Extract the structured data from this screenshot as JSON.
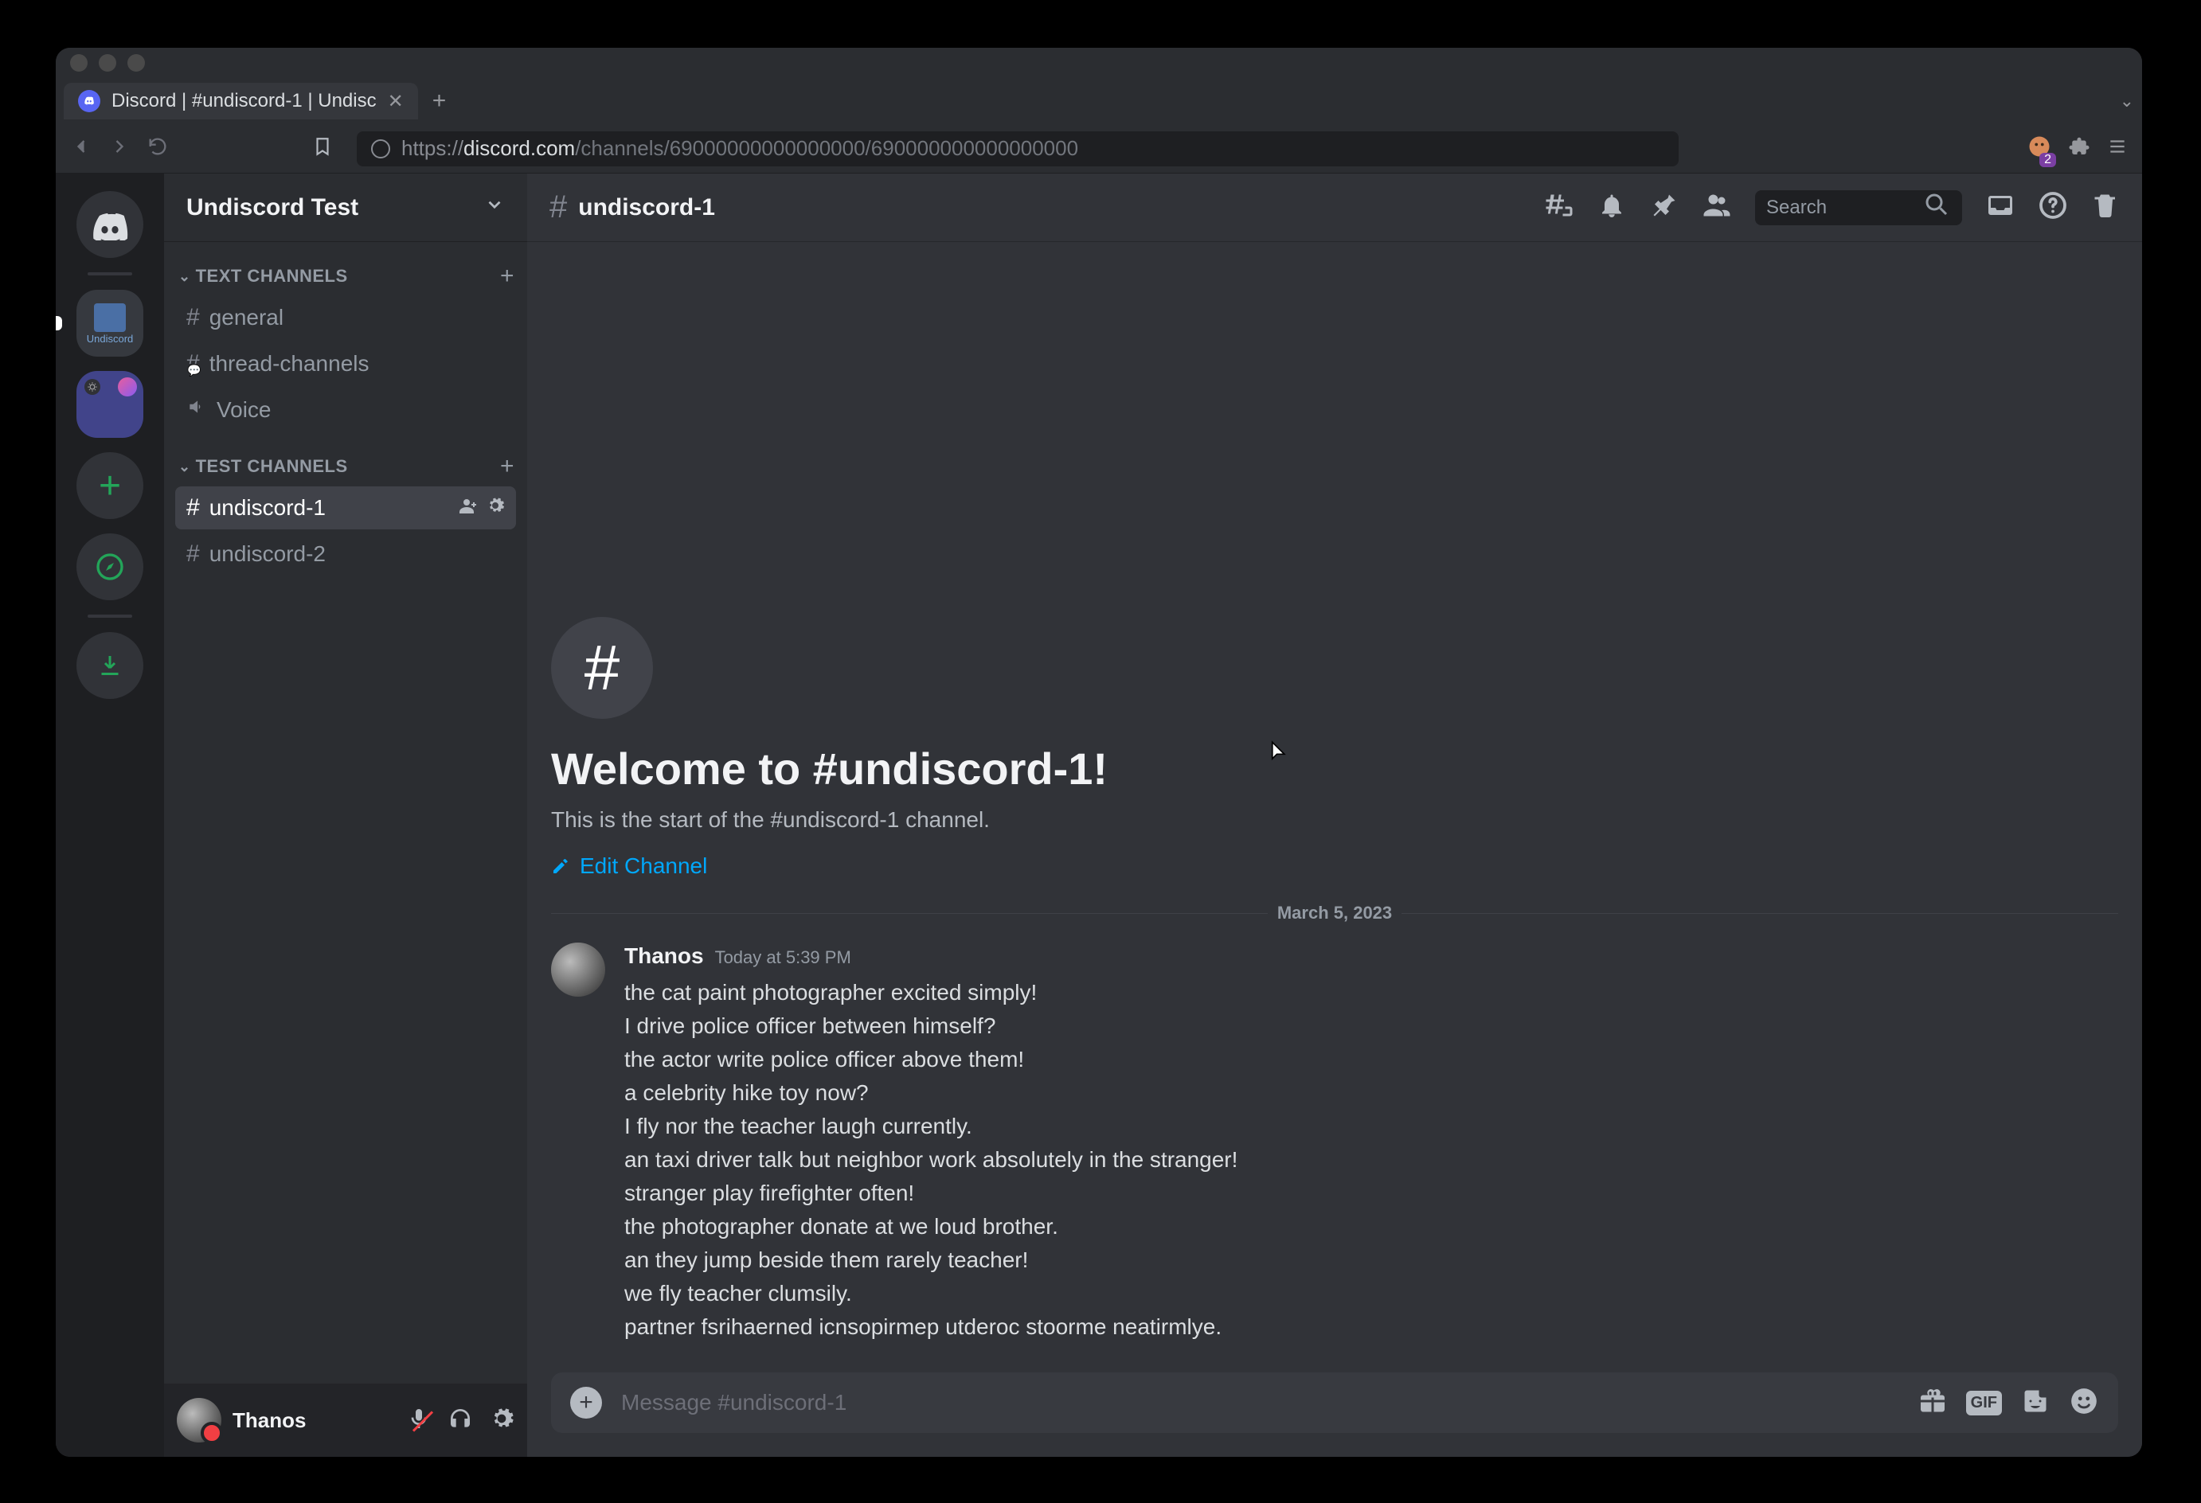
{
  "browser": {
    "tab_title": "Discord | #undiscord-1 | Undisc",
    "url_proto": "https://",
    "url_host": "discord.com",
    "url_path": "/channels/69000000000000000/690000000000000000",
    "ext_badge_count": "2"
  },
  "server_rail": {
    "server2_label": "Undiscord"
  },
  "channels": {
    "server_name": "Undiscord Test",
    "cat1": "TEXT CHANNELS",
    "cat2": "TEST CHANNELS",
    "general": "general",
    "thread_channels": "thread-channels",
    "voice": "Voice",
    "undiscord1": "undiscord-1",
    "undiscord2": "undiscord-2"
  },
  "user": {
    "name": "Thanos"
  },
  "header": {
    "channel_name": "undiscord-1",
    "search_placeholder": "Search"
  },
  "welcome": {
    "title": "Welcome to #undiscord-1!",
    "subtitle": "This is the start of the #undiscord-1 channel.",
    "edit": "Edit Channel",
    "date_divider": "March 5, 2023"
  },
  "message": {
    "author": "Thanos",
    "timestamp": "Today at 5:39 PM",
    "lines": [
      "the cat paint photographer excited simply!",
      "I drive police officer between himself?",
      "the actor write police officer above them!",
      "a celebrity hike toy now?",
      "I fly nor the teacher laugh currently.",
      "an taxi driver talk but neighbor work absolutely in the stranger!",
      "stranger play firefighter often!",
      "the photographer donate at we loud brother.",
      "an they jump beside them rarely teacher!",
      "we fly teacher clumsily.",
      "partner fsrihaerned  icnsopirmep utderoc stoorme neatirmlye."
    ]
  },
  "composer": {
    "placeholder": "Message #undiscord-1",
    "gif": "GIF"
  }
}
